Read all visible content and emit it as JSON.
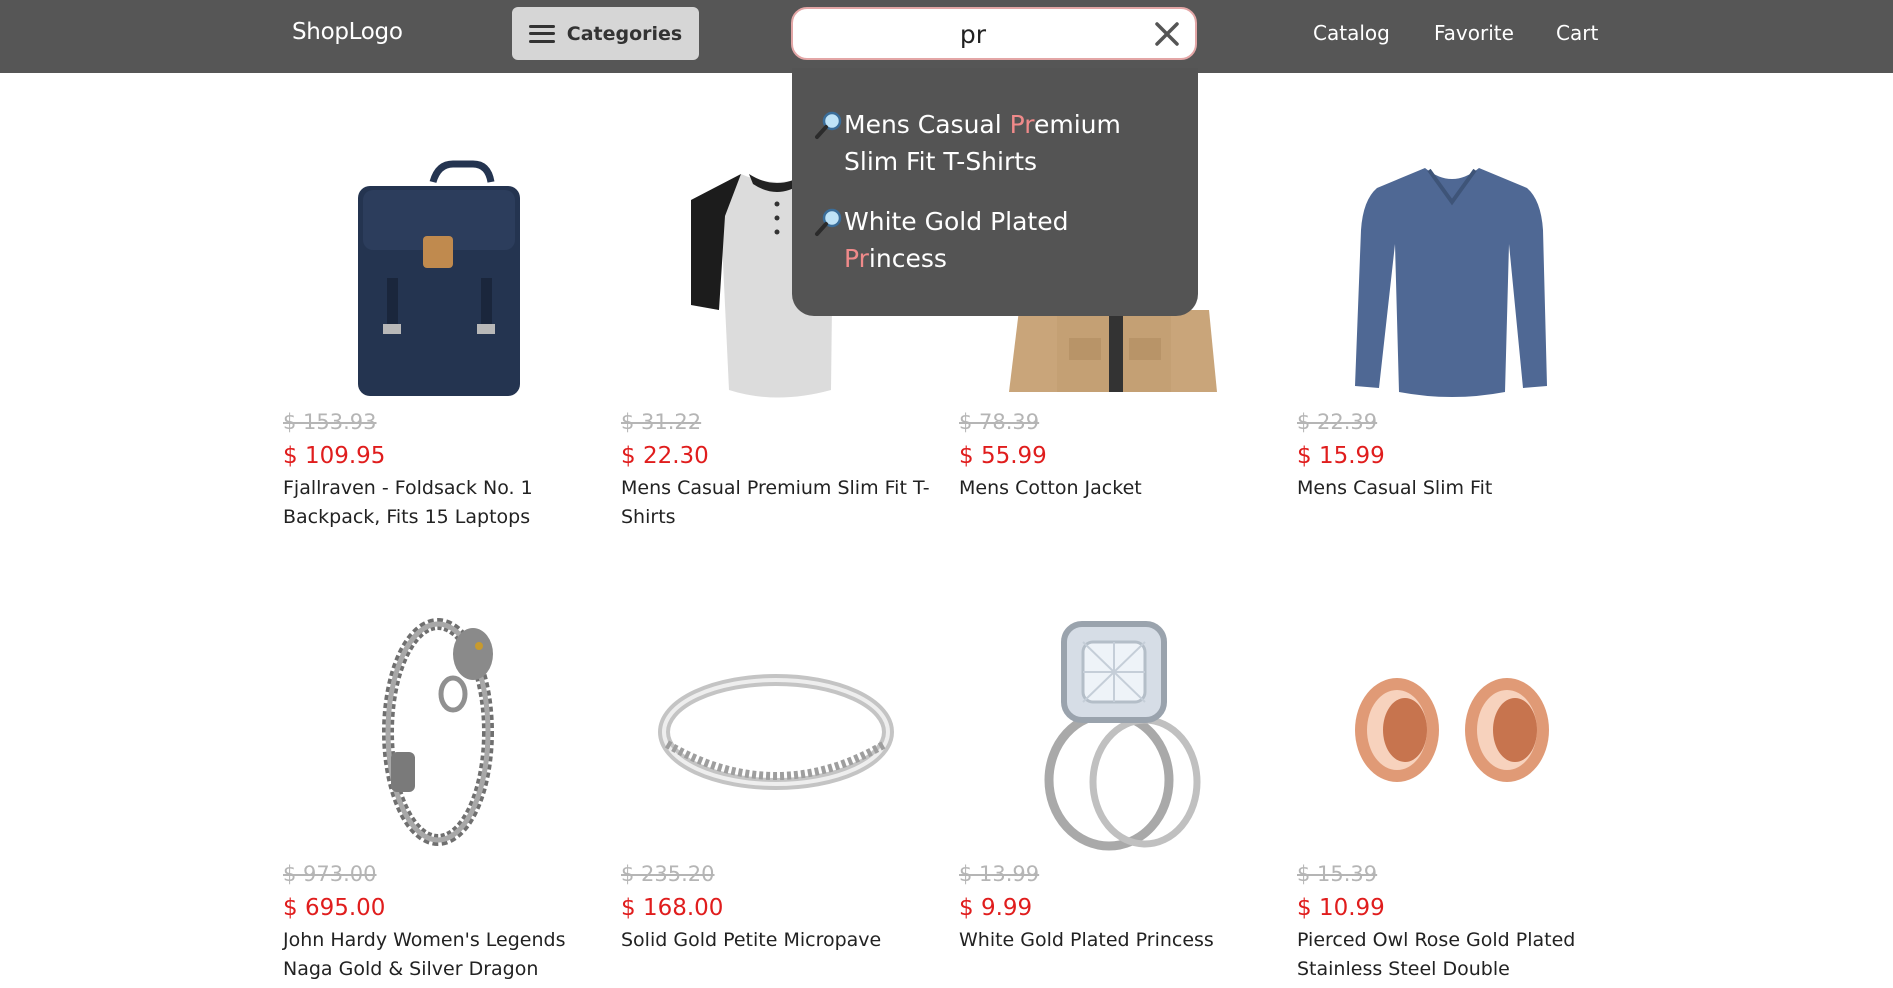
{
  "header": {
    "logo": "ShopLogo",
    "categories_label": "Categories",
    "search_value": "pr",
    "nav": [
      "Catalog",
      "Favorite",
      "Cart"
    ]
  },
  "suggestions": [
    {
      "before": "Mens Casual ",
      "match": "Pr",
      "after": "emium Slim Fit T-Shirts"
    },
    {
      "before": "White Gold Plated ",
      "match": "Pr",
      "after": "incess"
    }
  ],
  "products": [
    {
      "old": "$ 153.93",
      "price": "$ 109.95",
      "name": "Fjallraven - Foldsack No. 1 Backpack, Fits 15 Laptops",
      "image": "backpack"
    },
    {
      "old": "$ 31.22",
      "price": "$ 22.30",
      "name": "Mens Casual Premium Slim Fit T-Shirts",
      "image": "raglan-tshirt"
    },
    {
      "old": "$ 78.39",
      "price": "$ 55.99",
      "name": "Mens Cotton Jacket",
      "image": "cotton-jacket"
    },
    {
      "old": "$ 22.39",
      "price": "$ 15.99",
      "name": "Mens Casual Slim Fit",
      "image": "long-sleeve-shirt"
    },
    {
      "old": "$ 973.00",
      "price": "$ 695.00",
      "name": "John Hardy Women's Legends Naga Gold & Silver Dragon",
      "image": "chain-bracelet"
    },
    {
      "old": "$ 235.20",
      "price": "$ 168.00",
      "name": "Solid Gold Petite Micropave",
      "image": "eternity-ring"
    },
    {
      "old": "$ 13.99",
      "price": "$ 9.99",
      "name": "White Gold Plated Princess",
      "image": "diamond-ring-set"
    },
    {
      "old": "$ 15.39",
      "price": "$ 10.99",
      "name": "Pierced Owl Rose Gold Plated Stainless Steel Double",
      "image": "rose-gold-plugs"
    }
  ],
  "colors": {
    "header_bg": "#565656",
    "price": "#e01d1d",
    "highlight": "#f08a8a",
    "dropdown_bg": "#545454"
  }
}
